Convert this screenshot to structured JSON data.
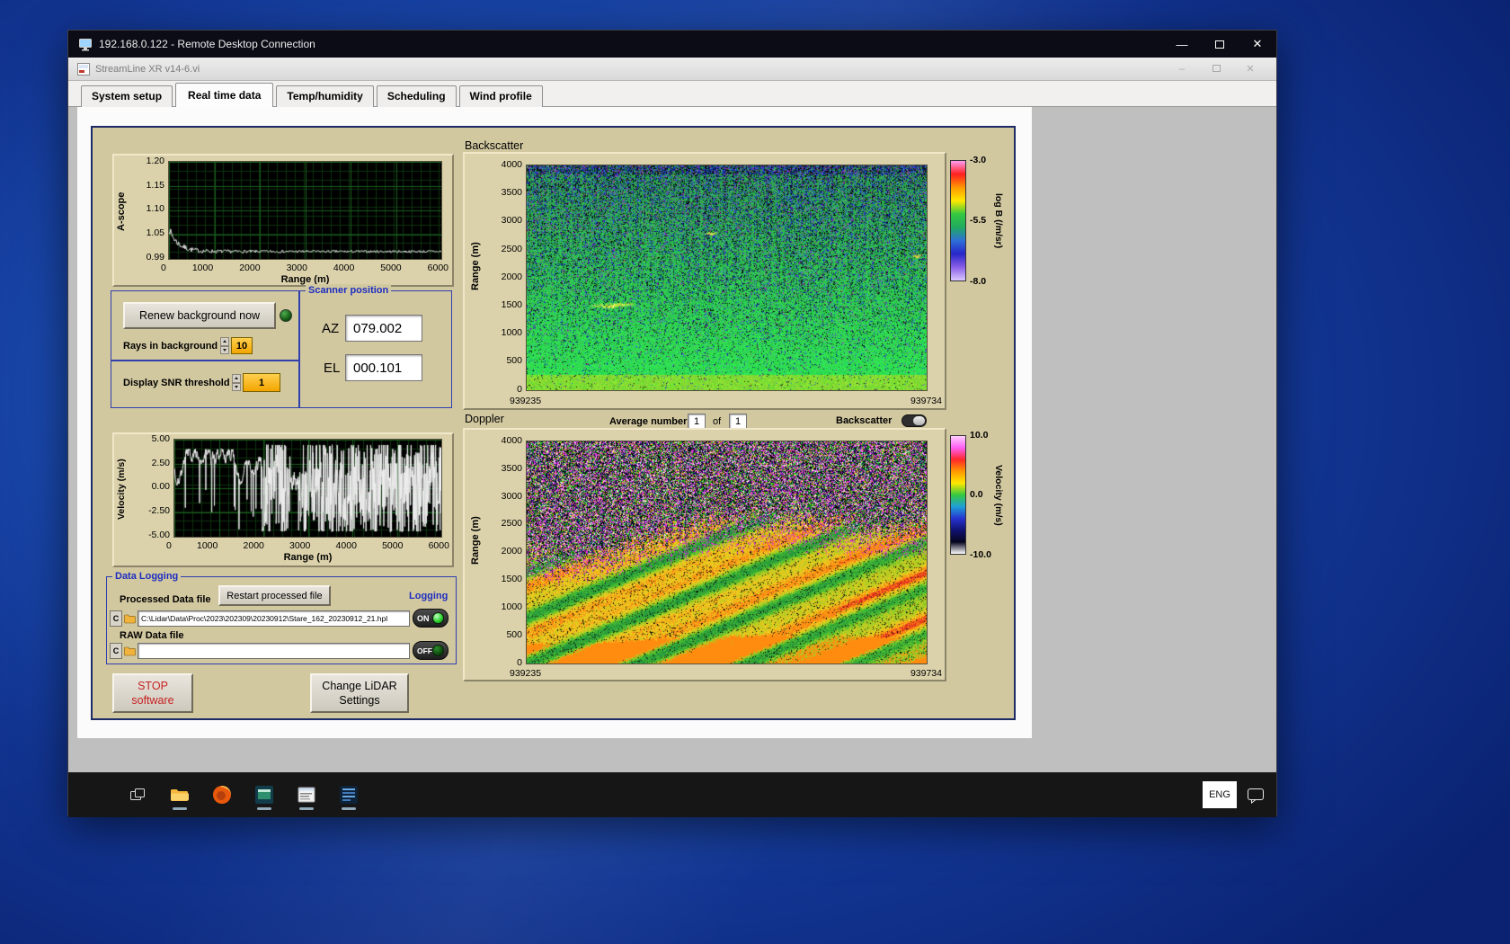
{
  "rdp": {
    "title": "192.168.0.122 - Remote Desktop Connection",
    "controls": {
      "minimize": "—",
      "close": "✕"
    }
  },
  "app": {
    "title": "StreamLine XR v14-6.vi",
    "controls": {
      "minimize": "–",
      "close": "✕"
    },
    "tabs": [
      {
        "label": "System setup"
      },
      {
        "label": "Real time data",
        "active": true
      },
      {
        "label": "Temp/humidity"
      },
      {
        "label": "Scheduling"
      },
      {
        "label": "Wind profile"
      }
    ]
  },
  "panel": {
    "renew_button": "Renew background now",
    "rays_label": "Rays in background",
    "rays_value": "10",
    "snr_label": "Display SNR threshold",
    "snr_value": "1",
    "scanner": {
      "title": "Scanner position",
      "az_label": "AZ",
      "az_value": "079.002",
      "el_label": "EL",
      "el_value": "000.101"
    },
    "backscatter_title": "Backscatter",
    "doppler_title": "Doppler",
    "average": {
      "label": "Average number",
      "value": "1",
      "of": "of",
      "total": "1"
    },
    "backscatter_toggle_label": "Backscatter",
    "logging": {
      "box_title": "Data Logging",
      "processed_label": "Processed Data file",
      "restart_button": "Restart processed file",
      "logging_label": "Logging",
      "drive_letter": "C",
      "processed_path": "C:\\Lidar\\Data\\Proc\\2023\\202309\\20230912\\Stare_162_20230912_21.hpl",
      "on_label": "ON",
      "raw_label": "RAW Data file",
      "raw_path": "",
      "off_label": "OFF"
    },
    "stop_button": "STOP\nsoftware",
    "change_button": "Change LiDAR\nSettings"
  },
  "taskbar": {
    "language": "ENG",
    "icons": [
      "task-view",
      "file-explorer",
      "firefox",
      "preview-app",
      "scan-scheduler",
      "lidar-app"
    ]
  },
  "chart_data": [
    {
      "type": "line",
      "name": "a_scope",
      "ylabel": "A-scope",
      "xlabel": "Range (m)",
      "xticks": [
        "0",
        "1000",
        "2000",
        "3000",
        "4000",
        "5000",
        "6000"
      ],
      "yticks": [
        "1.20",
        "1.15",
        "1.10",
        "1.05",
        "0.99"
      ],
      "x_range_m": [
        0,
        6000
      ],
      "y_range": [
        0.99,
        1.2
      ],
      "baseline": 0.995,
      "initial_spike": 1.05,
      "description": "White A-scope trace on black gridded background: sharp spike near range 0 decaying to a flat noisy baseline around 0.995"
    },
    {
      "type": "line",
      "name": "velocity",
      "ylabel": "Velocity (m/s)",
      "xlabel": "Range (m)",
      "xticks": [
        "0",
        "1000",
        "2000",
        "3000",
        "4000",
        "5000",
        "6000"
      ],
      "yticks": [
        "5.00",
        "2.50",
        "0.00",
        "-2.50",
        "-5.00"
      ],
      "x_range_m": [
        0,
        6000
      ],
      "y_range": [
        -5,
        5
      ],
      "description": "White velocity trace: coherent values roughly 1-4.5 m/s with dips below 0 out to ~2000 m, then full-scale saturated noise (-5 to 5 m/s) at longer ranges"
    },
    {
      "type": "heatmap",
      "name": "backscatter",
      "title": "Backscatter",
      "ylabel": "Range (m)",
      "yticks": [
        "4000",
        "3500",
        "3000",
        "2500",
        "2000",
        "1500",
        "1000",
        "500",
        "0"
      ],
      "y_range_m": [
        0,
        4000
      ],
      "x_start": "939235",
      "x_end": "939734",
      "colorbar": {
        "label": "log B (/m/sr)",
        "ticks": [
          "-3.0",
          "-5.5",
          "-8.0"
        ],
        "z_range": [
          -8.0,
          -3.0
        ],
        "colors": [
          "#ff9cf0",
          "#ff2020",
          "#ff9800",
          "#ffe800",
          "#35c840",
          "#1faa60",
          "#2e6fd8",
          "#2726c8",
          "#8a5fe8",
          "#d9c8ff"
        ]
      },
      "description": "Time-height backscatter: mostly green (~-5.5) with dark blue/black speckle increasing with altitude, brighter yellow-green near the surface, small yellow cloud streak near 1500 m"
    },
    {
      "type": "heatmap",
      "name": "doppler",
      "title": "Doppler",
      "ylabel": "Range (m)",
      "yticks": [
        "4000",
        "3500",
        "3000",
        "2500",
        "2000",
        "1500",
        "1000",
        "500",
        "0"
      ],
      "y_range_m": [
        0,
        4000
      ],
      "x_start": "939235",
      "x_end": "939734",
      "colorbar": {
        "label": "Velocity (m/s)",
        "ticks": [
          "10.0",
          "0.0",
          "-10.0"
        ],
        "z_range": [
          -10.0,
          10.0
        ],
        "colors": [
          "#ffd0ff",
          "#ff5ef2",
          "#ff2828",
          "#ff9800",
          "#ffe800",
          "#35c840",
          "#1f9fd8",
          "#2733d0",
          "#101270",
          "#05051e",
          "#ffffff"
        ]
      },
      "description": "Time-height Doppler velocity: random magenta/green/black noise aloft; coherent yellow-orange diagonal bands (~2-6 m/s) below ~2000-2700 m with red patches near the right edge"
    }
  ]
}
